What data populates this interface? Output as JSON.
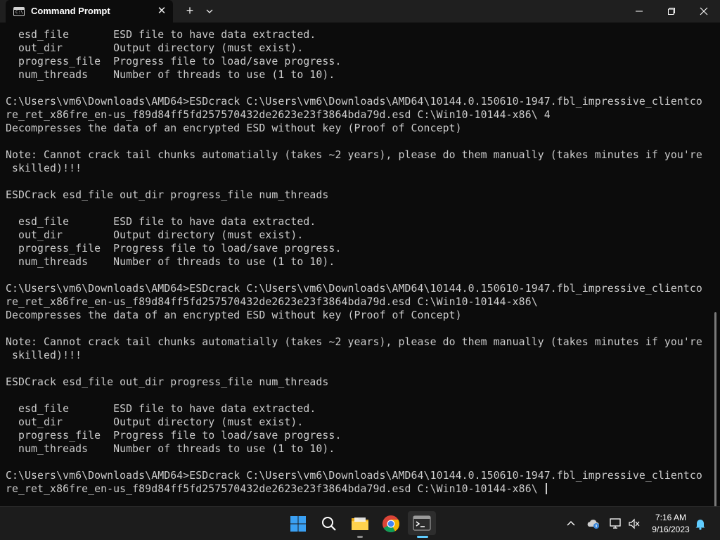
{
  "window": {
    "tab_title": "Command Prompt",
    "tab_icon_text": "C:\\",
    "new_tab_label": "+",
    "tab_close_label": "✕"
  },
  "terminal": {
    "lines": [
      "  esd_file       ESD file to have data extracted.",
      "  out_dir        Output directory (must exist).",
      "  progress_file  Progress file to load/save progress.",
      "  num_threads    Number of threads to use (1 to 10).",
      "",
      "C:\\Users\\vm6\\Downloads\\AMD64>ESDcrack C:\\Users\\vm6\\Downloads\\AMD64\\10144.0.150610-1947.fbl_impressive_clientco",
      "re_ret_x86fre_en-us_f89d84ff5fd257570432de2623e23f3864bda79d.esd C:\\Win10-10144-x86\\ 4",
      "Decompresses the data of an encrypted ESD without key (Proof of Concept)",
      "",
      "Note: Cannot crack tail chunks automatially (takes ~2 years), please do them manually (takes minutes if you're",
      " skilled)!!!",
      "",
      "ESDCrack esd_file out_dir progress_file num_threads",
      "",
      "  esd_file       ESD file to have data extracted.",
      "  out_dir        Output directory (must exist).",
      "  progress_file  Progress file to load/save progress.",
      "  num_threads    Number of threads to use (1 to 10).",
      "",
      "C:\\Users\\vm6\\Downloads\\AMD64>ESDcrack C:\\Users\\vm6\\Downloads\\AMD64\\10144.0.150610-1947.fbl_impressive_clientco",
      "re_ret_x86fre_en-us_f89d84ff5fd257570432de2623e23f3864bda79d.esd C:\\Win10-10144-x86\\",
      "Decompresses the data of an encrypted ESD without key (Proof of Concept)",
      "",
      "Note: Cannot crack tail chunks automatially (takes ~2 years), please do them manually (takes minutes if you're",
      " skilled)!!!",
      "",
      "ESDCrack esd_file out_dir progress_file num_threads",
      "",
      "  esd_file       ESD file to have data extracted.",
      "  out_dir        Output directory (must exist).",
      "  progress_file  Progress file to load/save progress.",
      "  num_threads    Number of threads to use (1 to 10).",
      "",
      "C:\\Users\\vm6\\Downloads\\AMD64>ESDcrack C:\\Users\\vm6\\Downloads\\AMD64\\10144.0.150610-1947.fbl_impressive_clientco",
      "re_ret_x86fre_en-us_f89d84ff5fd257570432de2623e23f3864bda79d.esd C:\\Win10-10144-x86\\ "
    ],
    "text_color": "#cccccc",
    "background": "#0c0c0c"
  },
  "taskbar": {
    "icons": [
      "start-icon",
      "search-icon",
      "file-explorer-icon",
      "chrome-icon",
      "terminal-icon"
    ],
    "tray_icons": [
      "chevron-up-icon",
      "onedrive-icon",
      "network-icon",
      "volume-muted-icon",
      "notification-bell-icon"
    ],
    "time": "7:16 AM",
    "date": "9/16/2023",
    "accent": "#60cdff"
  }
}
